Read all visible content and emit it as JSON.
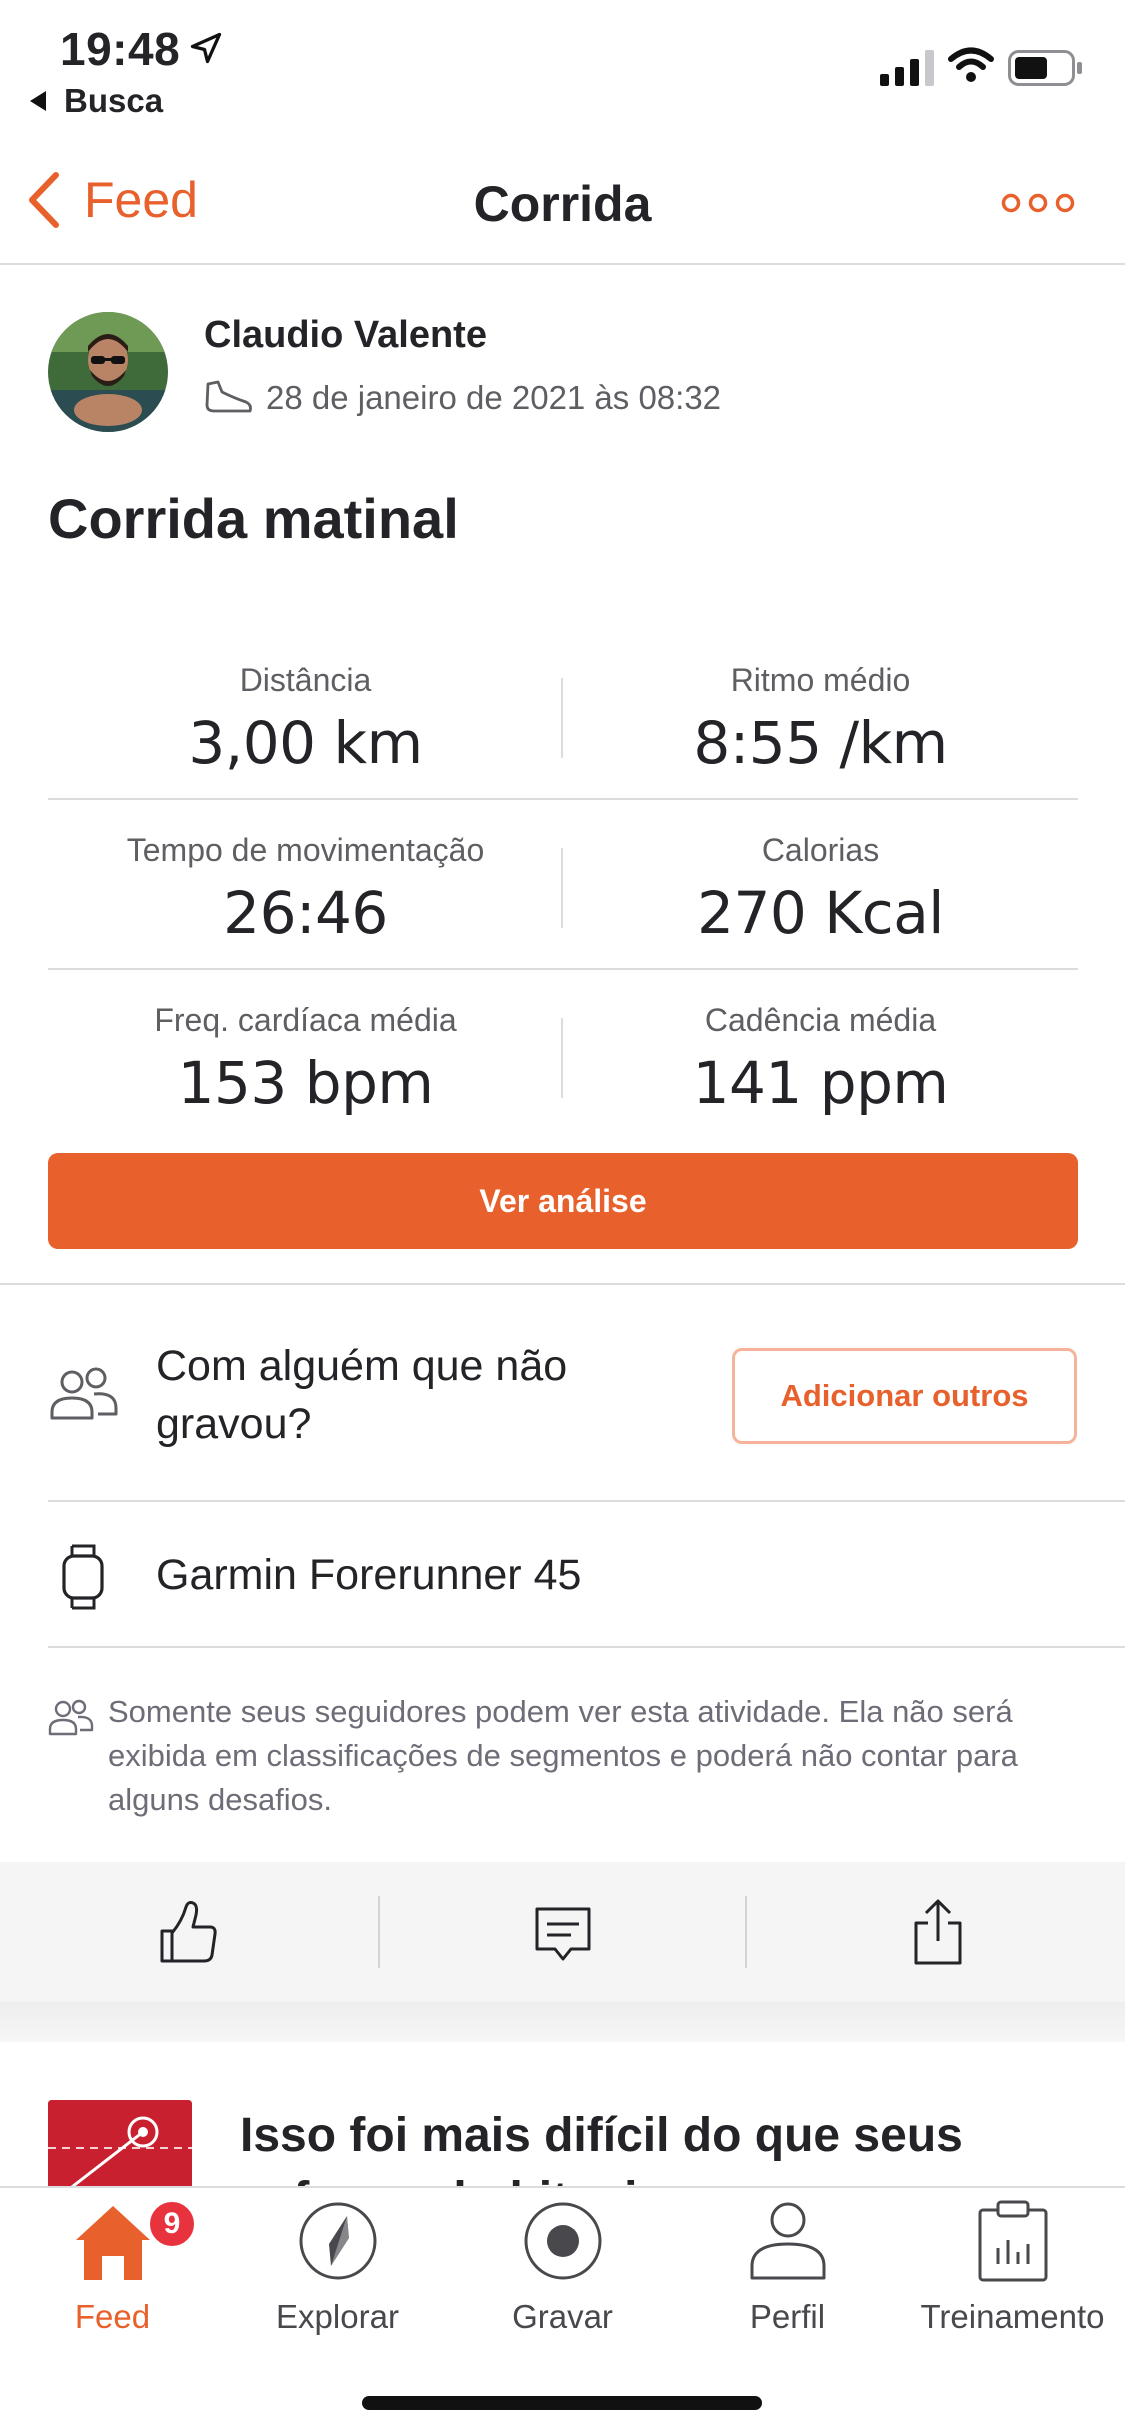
{
  "status_bar": {
    "time": "19:48",
    "back_app": "Busca"
  },
  "nav": {
    "back_label": "Feed",
    "title": "Corrida"
  },
  "activity": {
    "athlete_name": "Claudio Valente",
    "datetime": "28 de janeiro de 2021 às 08:32",
    "title": "Corrida matinal"
  },
  "stats": [
    {
      "label": "Distância",
      "value": "3,00 km"
    },
    {
      "label": "Ritmo médio",
      "value": "8:55 /km"
    },
    {
      "label": "Tempo de movimentação",
      "value": "26:46"
    },
    {
      "label": "Calorias",
      "value": "270 Kcal"
    },
    {
      "label": "Freq. cardíaca média",
      "value": "153 bpm"
    },
    {
      "label": "Cadência média",
      "value": "141 ppm"
    }
  ],
  "analysis_button": "Ver análise",
  "with_others": {
    "text": "Com alguém que não gravou?",
    "button": "Adicionar outros"
  },
  "device": {
    "name": "Garmin Forerunner 45"
  },
  "privacy_notice": "Somente seus seguidores podem ver esta atividade. Ela não será exibida em classificações de segmentos e poderá não contar para alguns desafios.",
  "actions": {
    "icons": [
      "thumbs-up-icon",
      "comment-icon",
      "share-icon"
    ]
  },
  "teaser": {
    "title": "Isso foi mais difícil do que seus esforços habituais"
  },
  "tabbar": {
    "items": [
      {
        "label": "Feed",
        "badge": "9",
        "icon": "home-icon"
      },
      {
        "label": "Explorar",
        "icon": "compass-icon"
      },
      {
        "label": "Gravar",
        "icon": "record-icon"
      },
      {
        "label": "Perfil",
        "icon": "profile-icon"
      },
      {
        "label": "Treinamento",
        "icon": "clipboard-chart-icon"
      }
    ]
  },
  "colors": {
    "accent": "#e8602c",
    "badge": "#e8323e",
    "text": "#242428",
    "muted": "#5e5e63",
    "divider": "#dcdcde"
  }
}
